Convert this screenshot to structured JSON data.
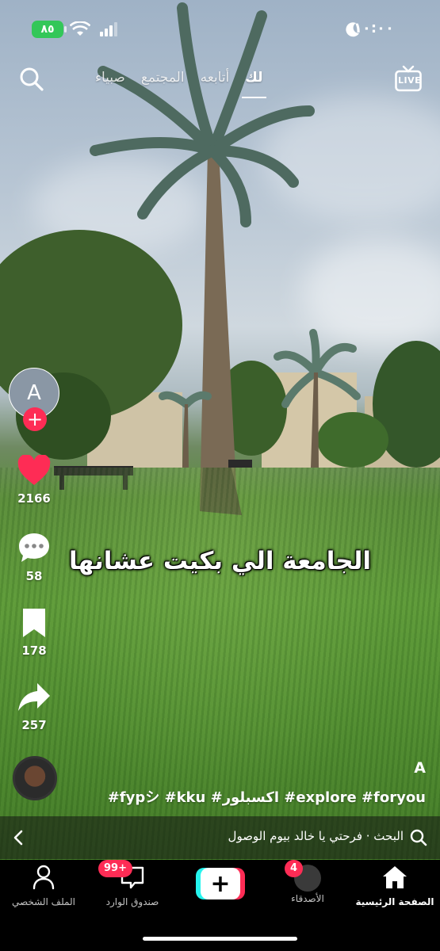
{
  "status_bar": {
    "battery": "٨٥",
    "time": "١٠:٠٠"
  },
  "top_nav": {
    "tabs": [
      {
        "label": "لك",
        "active": true
      },
      {
        "label": "أتابعه",
        "active": false
      },
      {
        "label": "المجتمع",
        "active": false
      },
      {
        "label": "صبياء",
        "active": false
      }
    ],
    "live_label": "LIVE"
  },
  "profile": {
    "avatar_letter": "A"
  },
  "actions": {
    "likes": "2166",
    "comments": "58",
    "saves": "178",
    "shares": "257"
  },
  "caption": "الجامعة الي بكيت عشانها",
  "video_info": {
    "author": "A",
    "hashtags": "#fypシ #kku #اكسبلور #explore #foryou"
  },
  "search_bar": {
    "text": "البحث · فرحتي يا خالد بيوم الوصول"
  },
  "bottom_nav": {
    "home": "الصفحة الرئيسية",
    "friends": "الأصدقاء",
    "friends_badge": "4",
    "inbox": "صندوق الوارد",
    "inbox_badge": "99+",
    "profile": "الملف الشخصي"
  },
  "colors": {
    "accent": "#fe2c55",
    "cyan": "#25f4ee",
    "battery": "#33c759"
  }
}
